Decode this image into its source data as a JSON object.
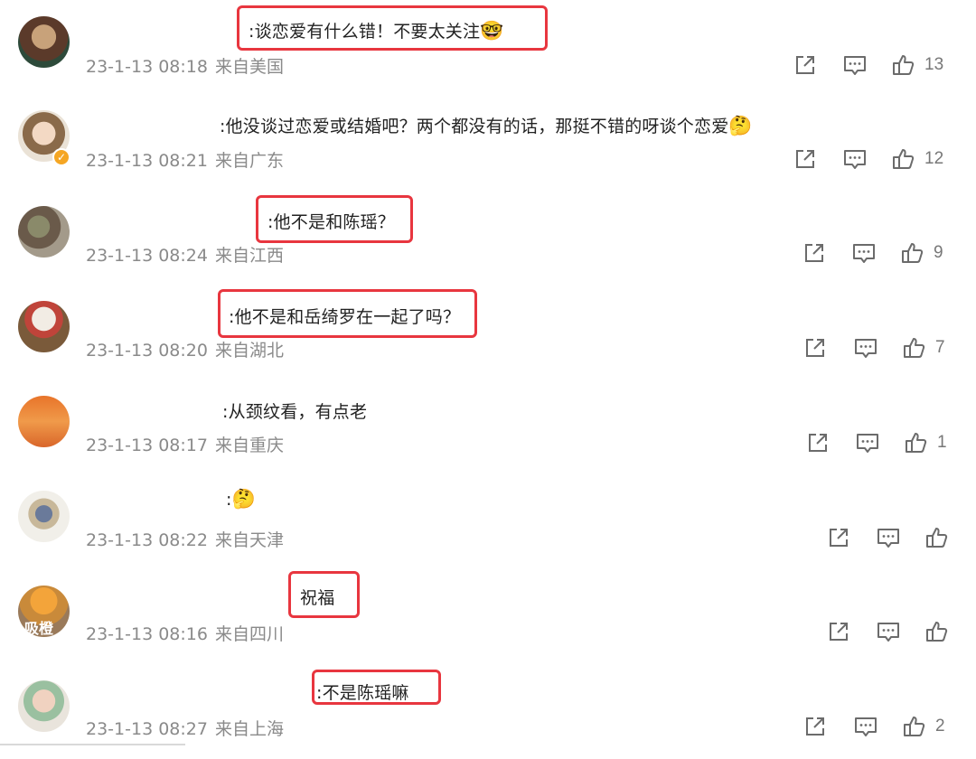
{
  "comments": [
    {
      "text": ":谈恋爱有什么错！不要太关注",
      "emoji": "🤓",
      "time": "23-1-13 08:18",
      "source": "来自美国",
      "likes": "13",
      "highlighted": true
    },
    {
      "text": ":他没谈过恋爱或结婚吧？两个都没有的话，那挺不错的呀谈个恋爱",
      "emoji": "🤔",
      "time": "23-1-13 08:21",
      "source": "来自广东",
      "likes": "12",
      "highlighted": false
    },
    {
      "text": ":他不是和陈瑶？",
      "emoji": "",
      "time": "23-1-13 08:24",
      "source": "来自江西",
      "likes": "9",
      "highlighted": true
    },
    {
      "text": ":他不是和岳绮罗在一起了吗？",
      "emoji": "",
      "time": "23-1-13 08:20",
      "source": "来自湖北",
      "likes": "7",
      "highlighted": true
    },
    {
      "text": ":从颈纹看，有点老",
      "emoji": "",
      "time": "23-1-13 08:17",
      "source": "来自重庆",
      "likes": "1",
      "highlighted": false
    },
    {
      "text": ":",
      "emoji": "🤔",
      "time": "23-1-13 08:22",
      "source": "来自天津",
      "likes": "",
      "highlighted": false
    },
    {
      "text": "祝福",
      "emoji": "",
      "time": "23-1-13 08:16",
      "source": "来自四川",
      "likes": "",
      "highlighted": true
    },
    {
      "text": ":不是陈瑶嘛",
      "emoji": "",
      "time": "23-1-13 08:27",
      "source": "来自上海",
      "likes": "2",
      "highlighted": true
    }
  ],
  "avatar_overlay_text": "吸橙",
  "verified_badge": "✓",
  "icons": {
    "share": "share-icon",
    "comment": "comment-icon",
    "like": "thumbs-up-icon"
  },
  "colors": {
    "highlight": "#e8363f",
    "meta": "#8a8a8a",
    "icon": "#6b6b6b",
    "verified": "#f5a623"
  }
}
